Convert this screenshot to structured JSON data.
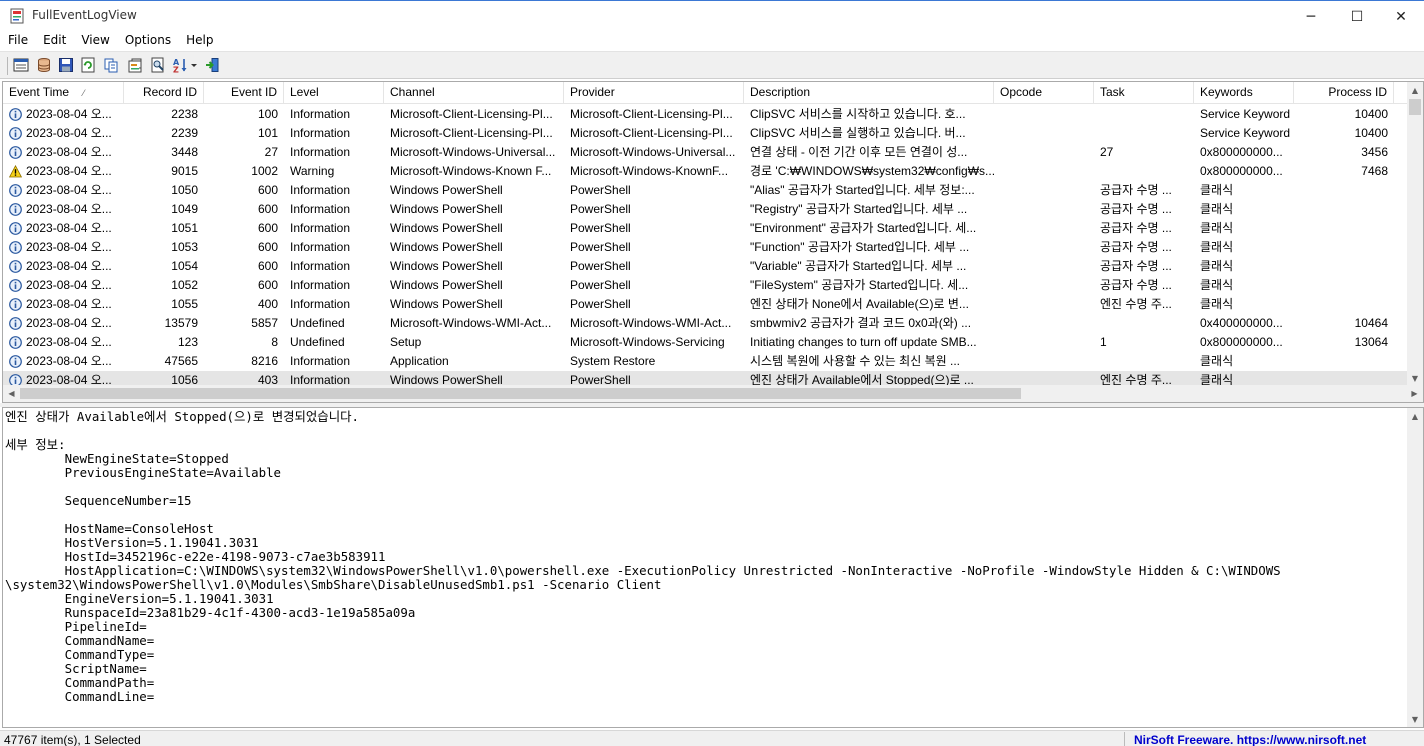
{
  "window": {
    "title": "FullEventLogView",
    "min_glyph": "─",
    "max_glyph": "☐",
    "close_glyph": "✕"
  },
  "menu": [
    "File",
    "Edit",
    "View",
    "Options",
    "Help"
  ],
  "toolbar": {
    "icons": [
      "properties-icon",
      "data-source-icon",
      "save-icon",
      "refresh-icon",
      "copy-icon",
      "html-report-icon",
      "find-icon",
      "sort-icon",
      "exit-icon"
    ]
  },
  "columns": [
    "Event Time",
    "Record ID",
    "Event ID",
    "Level",
    "Channel",
    "Provider",
    "Description",
    "Opcode",
    "Task",
    "Keywords",
    "Process ID"
  ],
  "sort_indicator": "⁄",
  "rows": [
    {
      "time": "2023-08-04 오...",
      "record": "2238",
      "event": "100",
      "level": "Information",
      "level_icon": "info",
      "channel": "Microsoft-Client-Licensing-Pl...",
      "provider": "Microsoft-Client-Licensing-Pl...",
      "desc": "ClipSVC 서비스를 시작하고 있습니다. 호...",
      "opcode": "",
      "task": "",
      "keywords": "Service Keyword",
      "pid": "10400"
    },
    {
      "time": "2023-08-04 오...",
      "record": "2239",
      "event": "101",
      "level": "Information",
      "level_icon": "info",
      "channel": "Microsoft-Client-Licensing-Pl...",
      "provider": "Microsoft-Client-Licensing-Pl...",
      "desc": "ClipSVC 서비스를 실행하고 있습니다. 버...",
      "opcode": "",
      "task": "",
      "keywords": "Service Keyword",
      "pid": "10400"
    },
    {
      "time": "2023-08-04 오...",
      "record": "3448",
      "event": "27",
      "level": "Information",
      "level_icon": "info",
      "channel": "Microsoft-Windows-Universal...",
      "provider": "Microsoft-Windows-Universal...",
      "desc": "연결 상태 - 이전 기간 이후 모든 연결이 성...",
      "opcode": "",
      "task": "27",
      "keywords": "0x800000000...",
      "pid": "3456"
    },
    {
      "time": "2023-08-04 오...",
      "record": "9015",
      "event": "1002",
      "level": "Warning",
      "level_icon": "warning",
      "channel": "Microsoft-Windows-Known F...",
      "provider": "Microsoft-Windows-KnownF...",
      "desc": "경로 'C:₩WINDOWS₩system32₩config₩s...",
      "opcode": "",
      "task": "",
      "keywords": "0x800000000...",
      "pid": "7468"
    },
    {
      "time": "2023-08-04 오...",
      "record": "1050",
      "event": "600",
      "level": "Information",
      "level_icon": "info",
      "channel": "Windows PowerShell",
      "provider": "PowerShell",
      "desc": "\"Alias\" 공급자가 Started입니다. 세부 정보:...",
      "opcode": "",
      "task": "공급자 수명 ...",
      "keywords": "클래식",
      "pid": ""
    },
    {
      "time": "2023-08-04 오...",
      "record": "1049",
      "event": "600",
      "level": "Information",
      "level_icon": "info",
      "channel": "Windows PowerShell",
      "provider": "PowerShell",
      "desc": "\"Registry\" 공급자가 Started입니다. 세부 ...",
      "opcode": "",
      "task": "공급자 수명 ...",
      "keywords": "클래식",
      "pid": ""
    },
    {
      "time": "2023-08-04 오...",
      "record": "1051",
      "event": "600",
      "level": "Information",
      "level_icon": "info",
      "channel": "Windows PowerShell",
      "provider": "PowerShell",
      "desc": "\"Environment\" 공급자가 Started입니다. 세...",
      "opcode": "",
      "task": "공급자 수명 ...",
      "keywords": "클래식",
      "pid": ""
    },
    {
      "time": "2023-08-04 오...",
      "record": "1053",
      "event": "600",
      "level": "Information",
      "level_icon": "info",
      "channel": "Windows PowerShell",
      "provider": "PowerShell",
      "desc": "\"Function\" 공급자가 Started입니다. 세부 ...",
      "opcode": "",
      "task": "공급자 수명 ...",
      "keywords": "클래식",
      "pid": ""
    },
    {
      "time": "2023-08-04 오...",
      "record": "1054",
      "event": "600",
      "level": "Information",
      "level_icon": "info",
      "channel": "Windows PowerShell",
      "provider": "PowerShell",
      "desc": "\"Variable\" 공급자가 Started입니다. 세부 ...",
      "opcode": "",
      "task": "공급자 수명 ...",
      "keywords": "클래식",
      "pid": ""
    },
    {
      "time": "2023-08-04 오...",
      "record": "1052",
      "event": "600",
      "level": "Information",
      "level_icon": "info",
      "channel": "Windows PowerShell",
      "provider": "PowerShell",
      "desc": "\"FileSystem\" 공급자가 Started입니다. 세...",
      "opcode": "",
      "task": "공급자 수명 ...",
      "keywords": "클래식",
      "pid": ""
    },
    {
      "time": "2023-08-04 오...",
      "record": "1055",
      "event": "400",
      "level": "Information",
      "level_icon": "info",
      "channel": "Windows PowerShell",
      "provider": "PowerShell",
      "desc": "엔진 상태가 None에서 Available(으)로 변...",
      "opcode": "",
      "task": "엔진 수명 주...",
      "keywords": "클래식",
      "pid": ""
    },
    {
      "time": "2023-08-04 오...",
      "record": "13579",
      "event": "5857",
      "level": "Undefined",
      "level_icon": "info",
      "channel": "Microsoft-Windows-WMI-Act...",
      "provider": "Microsoft-Windows-WMI-Act...",
      "desc": "smbwmiv2 공급자가 결과 코드 0x0과(와) ...",
      "opcode": "",
      "task": "",
      "keywords": "0x400000000...",
      "pid": "10464"
    },
    {
      "time": "2023-08-04 오...",
      "record": "123",
      "event": "8",
      "level": "Undefined",
      "level_icon": "info",
      "channel": "Setup",
      "provider": "Microsoft-Windows-Servicing",
      "desc": "Initiating changes to turn off update SMB...",
      "opcode": "",
      "task": "1",
      "keywords": "0x800000000...",
      "pid": "13064"
    },
    {
      "time": "2023-08-04 오...",
      "record": "47565",
      "event": "8216",
      "level": "Information",
      "level_icon": "info",
      "channel": "Application",
      "provider": "System Restore",
      "desc": "시스템 복원에 사용할 수 있는 최신 복원 ...",
      "opcode": "",
      "task": "",
      "keywords": "클래식",
      "pid": ""
    },
    {
      "time": "2023-08-04 오...",
      "record": "1056",
      "event": "403",
      "level": "Information",
      "level_icon": "info",
      "channel": "Windows PowerShell",
      "provider": "PowerShell",
      "desc": "엔진 상태가 Available에서 Stopped(으)로 ...",
      "opcode": "",
      "task": "엔진 수명 주...",
      "keywords": "클래식",
      "pid": "",
      "selected": true
    }
  ],
  "detail": {
    "text": "엔진 상태가 Available에서 Stopped(으)로 변경되었습니다.\n\n세부 정보:\n        NewEngineState=Stopped\n        PreviousEngineState=Available\n\n        SequenceNumber=15\n\n        HostName=ConsoleHost\n        HostVersion=5.1.19041.3031\n        HostId=3452196c-e22e-4198-9073-c7ae3b583911\n        HostApplication=C:\\WINDOWS\\system32\\WindowsPowerShell\\v1.0\\powershell.exe -ExecutionPolicy Unrestricted -NonInteractive -NoProfile -WindowStyle Hidden & C:\\WINDOWS\n\\system32\\WindowsPowerShell\\v1.0\\Modules\\SmbShare\\DisableUnusedSmb1.ps1 -Scenario Client\n        EngineVersion=5.1.19041.3031\n        RunspaceId=23a81b29-4c1f-4300-acd3-1e19a585a09a\n        PipelineId=\n        CommandName=\n        CommandType=\n        ScriptName=\n        CommandPath=\n        CommandLine="
  },
  "status": {
    "items": "47767 item(s), 1 Selected",
    "link": "NirSoft Freeware. https://www.nirsoft.net"
  },
  "scroll_glyphs": {
    "up": "▲",
    "down": "▼",
    "left": "◀",
    "right": "▶"
  }
}
